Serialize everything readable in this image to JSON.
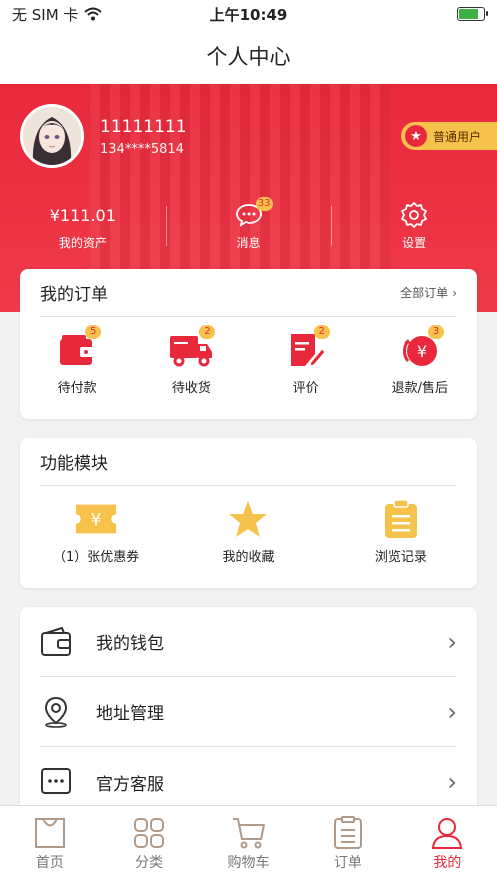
{
  "status": {
    "carrier": "无 SIM 卡",
    "time": "上午10:49"
  },
  "title": "个人中心",
  "profile": {
    "name": "11111111",
    "phone": "134****5814",
    "level": "普通用户"
  },
  "stats": [
    {
      "value": "¥111.01",
      "label": "我的资产"
    },
    {
      "label": "消息",
      "badge": "33"
    },
    {
      "label": "设置"
    }
  ],
  "orders": {
    "title": "我的订单",
    "all_label": "全部订单",
    "items": [
      {
        "label": "待付款",
        "badge": "5"
      },
      {
        "label": "待收货",
        "badge": "2"
      },
      {
        "label": "评价",
        "badge": "2"
      },
      {
        "label": "退款/售后",
        "badge": "3"
      }
    ]
  },
  "features": {
    "title": "功能模块",
    "items": [
      {
        "label": "（1）张优惠券"
      },
      {
        "label": "我的收藏"
      },
      {
        "label": "浏览记录"
      }
    ]
  },
  "menu": [
    {
      "label": "我的钱包",
      "icon": "wallet-icon"
    },
    {
      "label": "地址管理",
      "icon": "location-icon"
    },
    {
      "label": "官方客服",
      "icon": "chat-icon"
    }
  ],
  "tabs": [
    {
      "label": "首页",
      "icon": "home-icon"
    },
    {
      "label": "分类",
      "icon": "grid-icon"
    },
    {
      "label": "购物车",
      "icon": "cart-icon"
    },
    {
      "label": "订单",
      "icon": "list-icon"
    },
    {
      "label": "我的",
      "icon": "user-icon",
      "active": true
    }
  ],
  "colors": {
    "accent": "#e8293b",
    "gold": "#f6c24c",
    "tab_inactive": "#b09a8a"
  }
}
